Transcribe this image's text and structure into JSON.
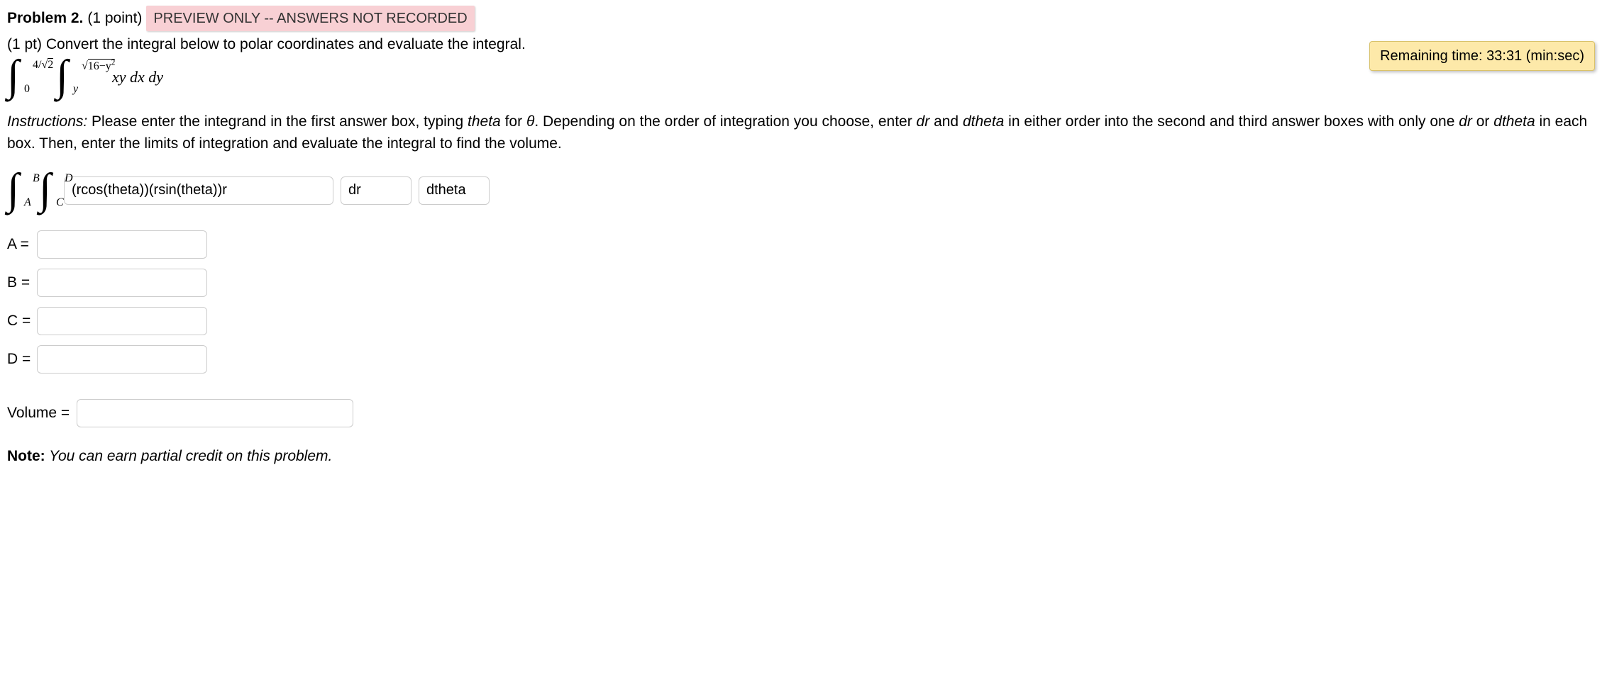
{
  "header": {
    "title": "Problem 2.",
    "points": "(1 point)",
    "preview_badge": "PREVIEW ONLY -- ANSWERS NOT RECORDED"
  },
  "timer": {
    "label": "Remaining time: 33:31 (min:sec)"
  },
  "prompt": {
    "pt": "(1 pt)",
    "text": "Convert the integral below to polar coordinates and evaluate the integral."
  },
  "integral": {
    "outer_upper": "4/√2",
    "outer_lower": "0",
    "inner_upper_pre": "√",
    "inner_upper_body": "16−y²",
    "inner_lower": "y",
    "integrand": "xy dx dy"
  },
  "instructions": {
    "lead": "Instructions:",
    "body1": " Please enter the integrand in the first answer box, typing ",
    "theta_word": "theta",
    "body2": " for ",
    "theta_sym": "θ",
    "body3": ". Depending on the order of integration you choose, enter ",
    "dr": "dr",
    "body4": " and ",
    "dtheta": "dtheta",
    "body5": " in either order into the second and third answer boxes with only one ",
    "body6": " or ",
    "body7": " in each box. Then, enter the limits of integration and evaluate the integral to find the volume."
  },
  "answer_integral": {
    "outer_upper": "B",
    "outer_lower": "A",
    "inner_upper": "D",
    "inner_lower": "C",
    "integrand_value": "(rcos(theta))(rsin(theta))r",
    "d1_value": "dr",
    "d2_value": "dtheta"
  },
  "limits": {
    "A_label": "A =",
    "A_value": "",
    "B_label": "B =",
    "B_value": "",
    "C_label": "C =",
    "C_value": "",
    "D_label": "D =",
    "D_value": ""
  },
  "volume": {
    "label": "Volume =",
    "value": ""
  },
  "note": {
    "lead": "Note:",
    "text": " You can earn partial credit on this problem."
  }
}
